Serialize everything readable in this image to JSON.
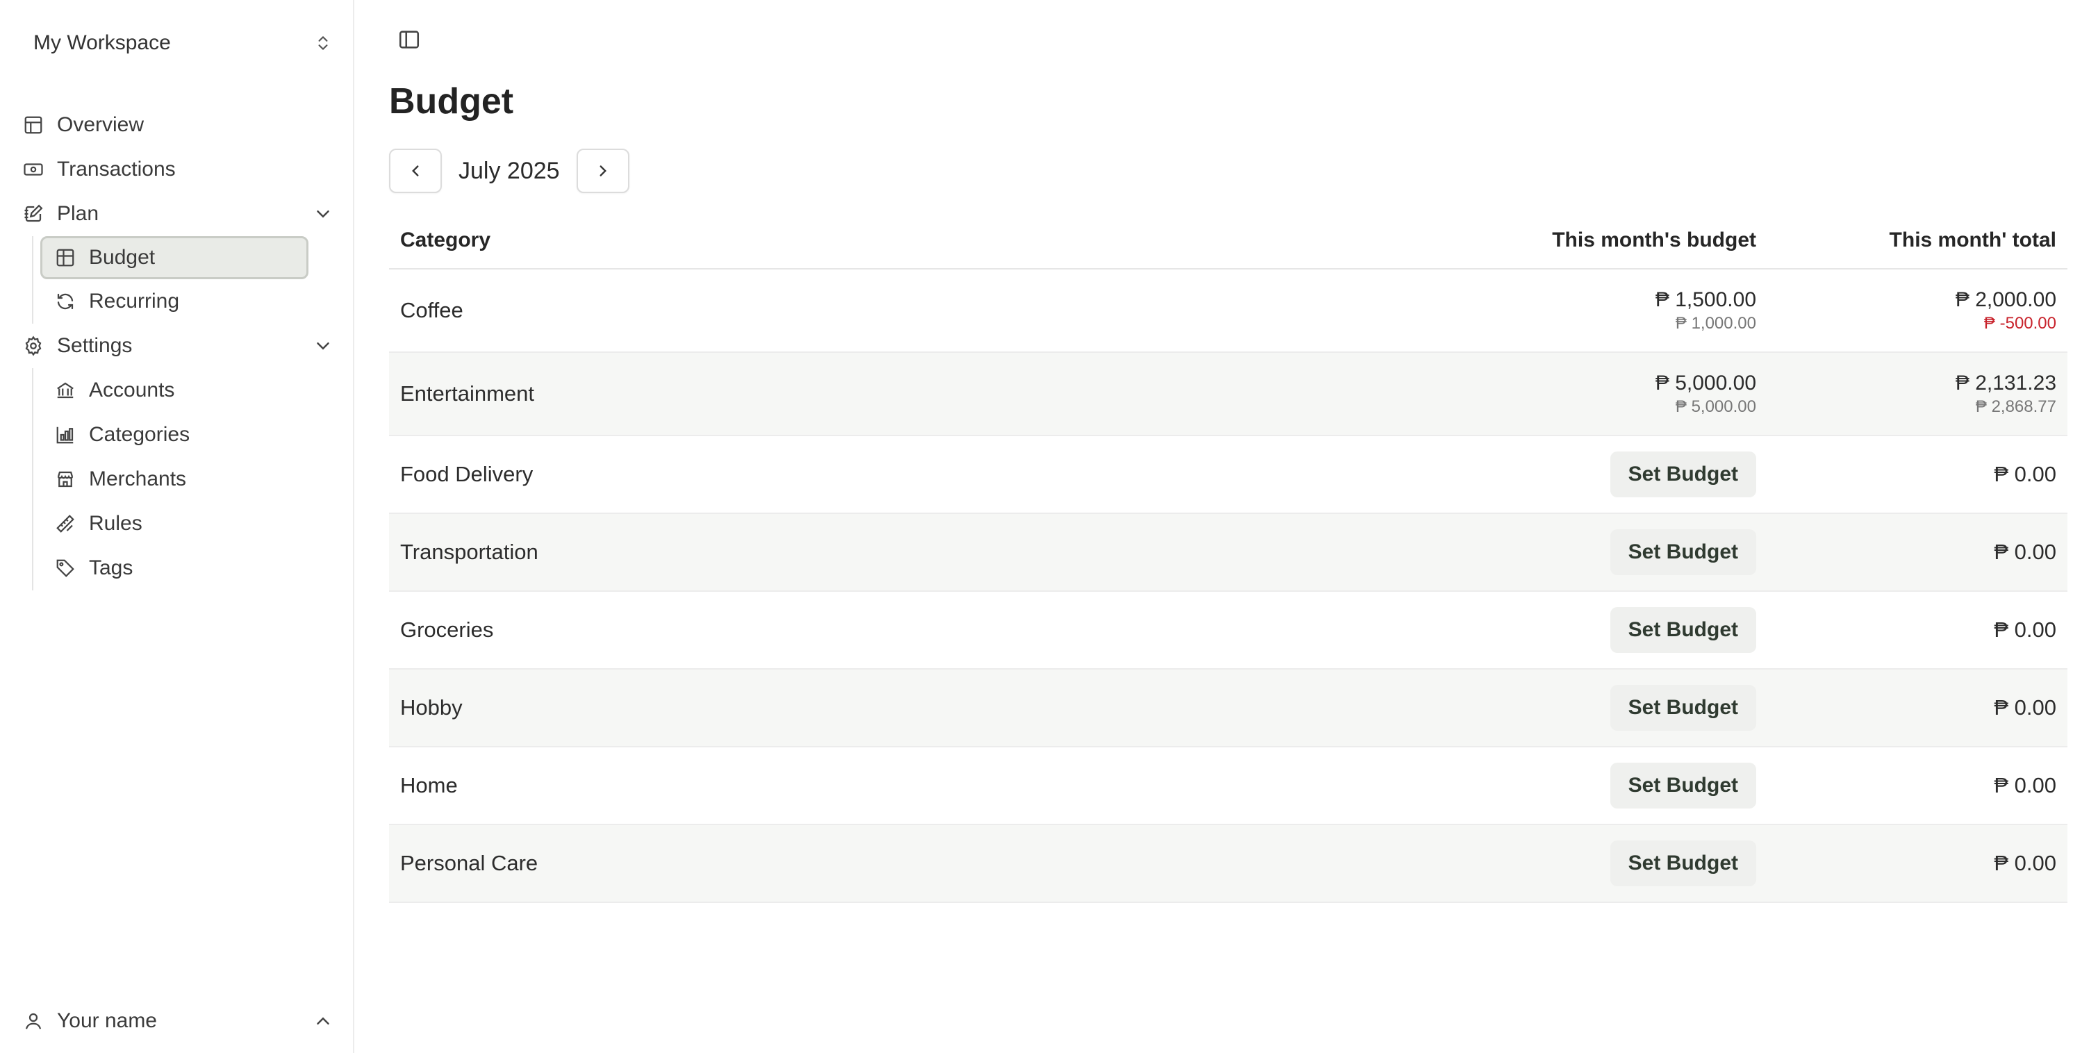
{
  "sidebar": {
    "workspace": "My Workspace",
    "items": [
      {
        "label": "Overview"
      },
      {
        "label": "Transactions"
      },
      {
        "label": "Plan"
      },
      {
        "label": "Budget"
      },
      {
        "label": "Recurring"
      },
      {
        "label": "Settings"
      },
      {
        "label": "Accounts"
      },
      {
        "label": "Categories"
      },
      {
        "label": "Merchants"
      },
      {
        "label": "Rules"
      },
      {
        "label": "Tags"
      }
    ],
    "user": "Your name"
  },
  "page": {
    "title": "Budget",
    "month": "July 2025"
  },
  "table": {
    "headers": {
      "category": "Category",
      "budget": "This month's budget",
      "total": "This month' total"
    },
    "set_budget_label": "Set Budget",
    "rows": [
      {
        "category": "Coffee",
        "budget": "₱ 1,500.00",
        "budget_sub": "₱ 1,000.00",
        "total": "₱ 2,000.00",
        "total_sub": "₱ -500.00"
      },
      {
        "category": "Entertainment",
        "budget": "₱ 5,000.00",
        "budget_sub": "₱ 5,000.00",
        "total": "₱ 2,131.23",
        "total_sub": "₱ 2,868.77"
      },
      {
        "category": "Food Delivery",
        "total": "₱ 0.00"
      },
      {
        "category": "Transportation",
        "total": "₱ 0.00"
      },
      {
        "category": "Groceries",
        "total": "₱ 0.00"
      },
      {
        "category": "Hobby",
        "total": "₱ 0.00"
      },
      {
        "category": "Home",
        "total": "₱ 0.00"
      },
      {
        "category": "Personal Care",
        "total": "₱ 0.00"
      }
    ]
  },
  "colors": {
    "negative": "#c8232c",
    "active_bg": "#e9ebe7"
  }
}
